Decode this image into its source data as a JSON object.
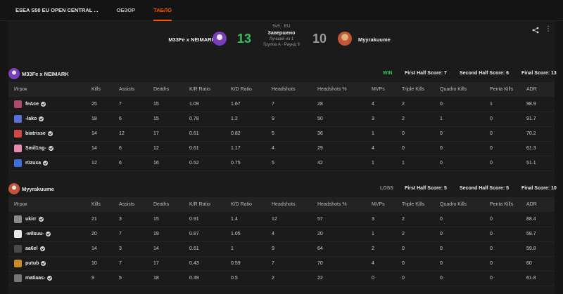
{
  "nav": {
    "title": "ESEA S50 EU OPEN CENTRAL ...",
    "tabs": [
      "ОБЗОР",
      "ТАБЛО"
    ],
    "active_tab": "ТАБЛО"
  },
  "match": {
    "team1": {
      "name": "M33Fe x NEIMARK",
      "score": "13"
    },
    "team2": {
      "name": "Myyrakuume",
      "score": "10"
    },
    "format": "5v5 · EU",
    "status": "Завершено",
    "best_of": "Лучший из 1",
    "group_round": "Группа A · Раунд 9",
    "share_icon": "share-icon",
    "menu_icon": "kebab-menu-icon"
  },
  "columns": [
    "Игрок",
    "Kills",
    "Assists",
    "Deaths",
    "K/R Ratio",
    "K/D Ratio",
    "Headshots",
    "Headshots %",
    "MVPs",
    "Triple Kills",
    "Quadro Kills",
    "Penta Kills",
    "ADR"
  ],
  "teams": [
    {
      "name": "M33Fe x NEIMARK",
      "result": "WIN",
      "first_half": "First Half Score: 7",
      "second_half": "Second Half Score: 6",
      "final": "Final Score: 13",
      "avatar_color": "#7a3fb8",
      "players": [
        {
          "name": "feAce",
          "color": "#b04a6a",
          "stats": [
            "25",
            "7",
            "15",
            "1.09",
            "1.67",
            "7",
            "28",
            "4",
            "2",
            "0",
            "1",
            "98.9"
          ]
        },
        {
          "name": "-lako",
          "color": "#5a6fd8",
          "stats": [
            "18",
            "6",
            "15",
            "0.78",
            "1.2",
            "9",
            "50",
            "3",
            "2",
            "1",
            "0",
            "91.7"
          ]
        },
        {
          "name": "biatrisse",
          "color": "#d04848",
          "stats": [
            "14",
            "12",
            "17",
            "0.61",
            "0.82",
            "5",
            "36",
            "1",
            "0",
            "0",
            "0",
            "70.2"
          ]
        },
        {
          "name": "Smil1ng-",
          "color": "#e68bb0",
          "stats": [
            "14",
            "6",
            "12",
            "0.61",
            "1.17",
            "4",
            "29",
            "4",
            "0",
            "0",
            "0",
            "61.3"
          ]
        },
        {
          "name": "r0zuxa",
          "color": "#3f6fd6",
          "stats": [
            "12",
            "6",
            "16",
            "0.52",
            "0.75",
            "5",
            "42",
            "1",
            "1",
            "0",
            "0",
            "51.1"
          ]
        }
      ]
    },
    {
      "name": "Myyrakuume",
      "result": "LOSS",
      "first_half": "First Half Score: 5",
      "second_half": "Second Half Score: 5",
      "final": "Final Score: 10",
      "avatar_color": "#c2543a",
      "players": [
        {
          "name": "ukirr",
          "color": "#8a8a8a",
          "stats": [
            "21",
            "3",
            "15",
            "0.91",
            "1.4",
            "12",
            "57",
            "3",
            "2",
            "0",
            "0",
            "88.4"
          ]
        },
        {
          "name": "-wilsuu-",
          "color": "#e8e8e8",
          "stats": [
            "20",
            "7",
            "19",
            "0.87",
            "1.05",
            "4",
            "20",
            "1",
            "2",
            "0",
            "0",
            "58.7"
          ]
        },
        {
          "name": "aa6el",
          "color": "#4a4a4a",
          "stats": [
            "14",
            "3",
            "14",
            "0.61",
            "1",
            "9",
            "64",
            "2",
            "0",
            "0",
            "0",
            "59.8"
          ]
        },
        {
          "name": "putub",
          "color": "#c98a2a",
          "stats": [
            "10",
            "7",
            "17",
            "0.43",
            "0.59",
            "7",
            "70",
            "4",
            "0",
            "0",
            "0",
            "60"
          ]
        },
        {
          "name": "matiaas-",
          "color": "#777777",
          "stats": [
            "9",
            "5",
            "18",
            "0.39",
            "0.5",
            "2",
            "22",
            "0",
            "0",
            "0",
            "0",
            "61.8"
          ]
        }
      ]
    }
  ],
  "colors": {
    "accent": "#ff5500",
    "win": "#32c25f",
    "loss": "#9a9a9a"
  }
}
